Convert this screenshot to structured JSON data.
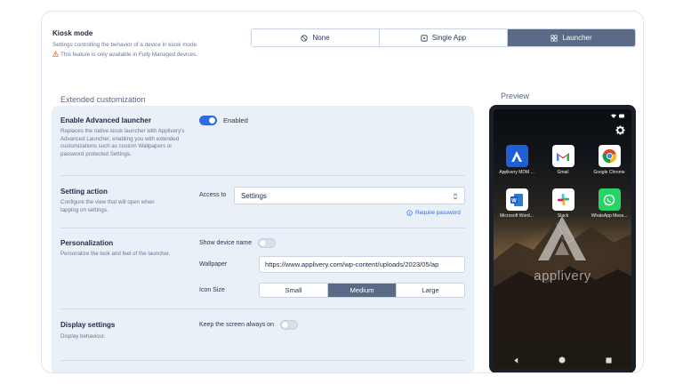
{
  "kiosk": {
    "title": "Kiosk mode",
    "description": "Settings controlling the behavior of a device in kiosk mode.",
    "warning": "This feature is only available in Fully Managed devices.",
    "options": [
      {
        "label": "None",
        "icon": "ban-icon"
      },
      {
        "label": "Single App",
        "icon": "app-square-icon"
      },
      {
        "label": "Launcher",
        "icon": "grid-icon"
      }
    ],
    "selected": "Launcher"
  },
  "extended": {
    "title": "Extended customization",
    "advanced_launcher": {
      "title": "Enable Advanced launcher",
      "description": "Replaces the native kiosk launcher with Applivery's Advanced Launcher, enabling you with extended customizations such as custom Wallpapers or password protected Settings.",
      "toggle_label": "Enabled",
      "enabled": true
    },
    "setting_action": {
      "title": "Setting action",
      "description": "Configure the view that will open when tapping on settings.",
      "access_label": "Access to",
      "access_value": "Settings",
      "require_password": "Require password"
    },
    "personalization": {
      "title": "Personalization",
      "description": "Personalize the look and feel of the launcher.",
      "show_device_name_label": "Show device name",
      "show_device_name": false,
      "wallpaper_label": "Wallpaper",
      "wallpaper_value": "https://www.applivery.com/wp-content/uploads/2023/05/ap",
      "icon_size_label": "Icon Size",
      "icon_sizes": [
        "Small",
        "Medium",
        "Large"
      ],
      "icon_size_selected": "Medium"
    },
    "display": {
      "title": "Display settings",
      "description": "Display behaviour.",
      "screen_on_label": "Keep the screen always on",
      "screen_on": false
    }
  },
  "preview": {
    "title": "Preview",
    "apps": [
      {
        "name": "Applivery MDM ...",
        "icon": "applivery-icon"
      },
      {
        "name": "Gmail",
        "icon": "gmail-icon"
      },
      {
        "name": "Google Chrome",
        "icon": "chrome-icon"
      },
      {
        "name": "Microsoft Word...",
        "icon": "word-icon"
      },
      {
        "name": "Slack",
        "icon": "slack-icon"
      },
      {
        "name": "WhatsApp Mess...",
        "icon": "whatsapp-icon"
      }
    ],
    "brand": "applivery"
  },
  "colors": {
    "accent": "#2f6cdf",
    "segment_active": "#5a6a87",
    "panel_bg": "#eaf0f8",
    "warning": "#e0653a"
  }
}
